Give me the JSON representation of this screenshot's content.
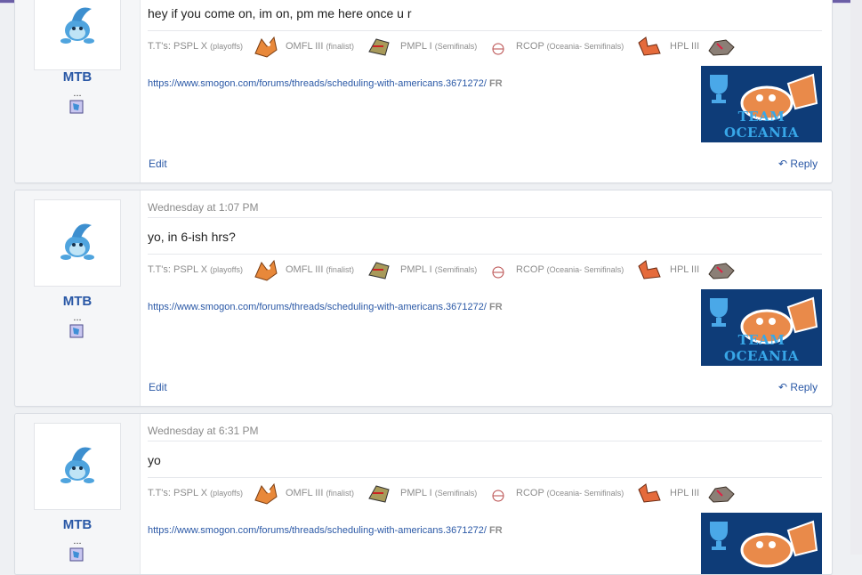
{
  "posts": [
    {
      "username": "MTB",
      "dots": "...",
      "date": "",
      "message": "hey if you come on, im on, pm me here once u r",
      "sig": {
        "tts_label": "T.T's: PSPL X",
        "tts_note": "(playoffs)",
        "omfl_label": "OMFL III",
        "omfl_note": "(finalist)",
        "pmpl_label": "PMPL I",
        "pmpl_note": "(Semifinals)",
        "rcop_label": "RCOP",
        "rcop_note": "(Oceania- Semifinals)",
        "hpl_label": "HPL III"
      },
      "link": "https://www.smogon.com/forums/threads/scheduling-with-americans.3671272/",
      "link_suffix": "FR",
      "banner_text": "TEAM OCEANIA",
      "edit_label": "Edit",
      "reply_label": "Reply"
    },
    {
      "username": "MTB",
      "dots": "...",
      "date": "Wednesday at 1:07 PM",
      "message": "yo, in 6-ish hrs?",
      "sig": {
        "tts_label": "T.T's: PSPL X",
        "tts_note": "(playoffs)",
        "omfl_label": "OMFL III",
        "omfl_note": "(finalist)",
        "pmpl_label": "PMPL I",
        "pmpl_note": "(Semifinals)",
        "rcop_label": "RCOP",
        "rcop_note": "(Oceania- Semifinals)",
        "hpl_label": "HPL III"
      },
      "link": "https://www.smogon.com/forums/threads/scheduling-with-americans.3671272/",
      "link_suffix": "FR",
      "banner_text": "TEAM OCEANIA",
      "edit_label": "Edit",
      "reply_label": "Reply"
    },
    {
      "username": "MTB",
      "dots": "...",
      "date": "Wednesday at 6:31 PM",
      "message": "yo",
      "sig": {
        "tts_label": "T.T's: PSPL X",
        "tts_note": "(playoffs)",
        "omfl_label": "OMFL III",
        "omfl_note": "(finalist)",
        "pmpl_label": "PMPL I",
        "pmpl_note": "(Semifinals)",
        "rcop_label": "RCOP",
        "rcop_note": "(Oceania- Semifinals)",
        "hpl_label": "HPL III"
      },
      "link": "https://www.smogon.com/forums/threads/scheduling-with-americans.3671272/",
      "link_suffix": "FR",
      "banner_text": "",
      "edit_label": "",
      "reply_label": ""
    }
  ],
  "icons": {
    "avatar": "manaphy-sprite-icon",
    "badge": "team-badge-icon",
    "reply": "reply-arrow-icon"
  },
  "colors": {
    "link": "#2a58a6",
    "accent": "#6b5fa6",
    "banner_bg": "#0e3c78"
  }
}
